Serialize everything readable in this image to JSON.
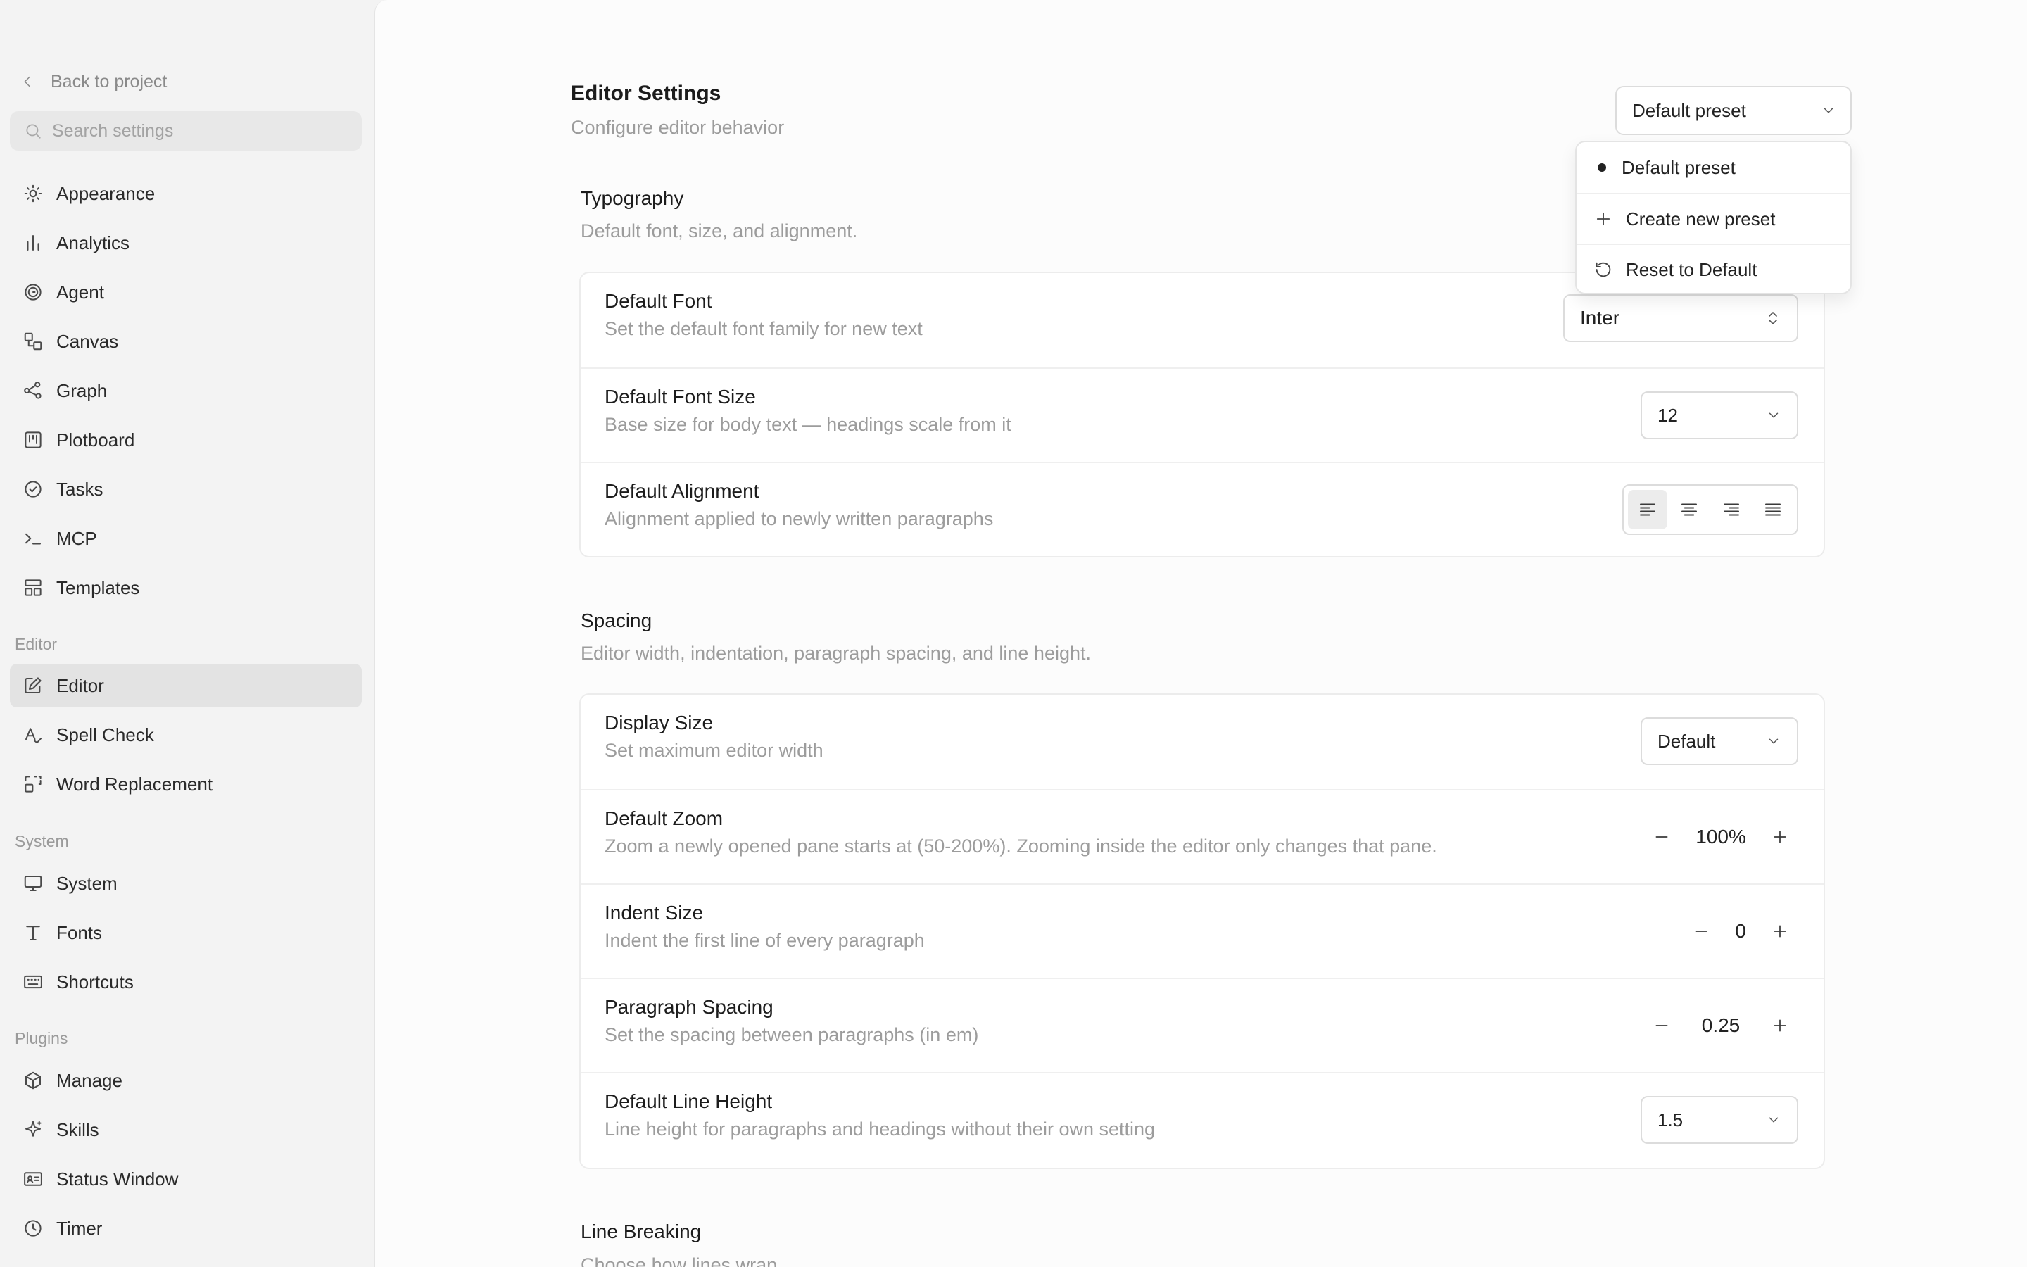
{
  "sidebar": {
    "back_label": "Back to project",
    "search_placeholder": "Search settings",
    "items_general": [
      {
        "label": "Appearance",
        "icon": "sun-icon"
      },
      {
        "label": "Analytics",
        "icon": "bar-chart-icon"
      },
      {
        "label": "Agent",
        "icon": "spiral-icon"
      },
      {
        "label": "Canvas",
        "icon": "shapes-icon"
      },
      {
        "label": "Graph",
        "icon": "graph-icon"
      },
      {
        "label": "Plotboard",
        "icon": "kanban-icon"
      },
      {
        "label": "Tasks",
        "icon": "check-circle-icon"
      },
      {
        "label": "MCP",
        "icon": "terminal-icon"
      },
      {
        "label": "Templates",
        "icon": "layout-template-icon"
      }
    ],
    "section_editor": "Editor",
    "items_editor": [
      {
        "label": "Editor",
        "icon": "edit-icon",
        "active": true
      },
      {
        "label": "Spell Check",
        "icon": "spell-check-icon"
      },
      {
        "label": "Word Replacement",
        "icon": "replace-icon"
      }
    ],
    "section_system": "System",
    "items_system": [
      {
        "label": "System",
        "icon": "monitor-icon"
      },
      {
        "label": "Fonts",
        "icon": "type-icon"
      },
      {
        "label": "Shortcuts",
        "icon": "keyboard-icon"
      }
    ],
    "section_plugins": "Plugins",
    "items_plugins": [
      {
        "label": "Manage",
        "icon": "package-icon"
      },
      {
        "label": "Skills",
        "icon": "sparkle-icon"
      },
      {
        "label": "Status Window",
        "icon": "id-card-icon"
      },
      {
        "label": "Timer",
        "icon": "clock-icon"
      }
    ]
  },
  "header": {
    "title": "Editor Settings",
    "subtitle": "Configure editor behavior",
    "preset_value": "Default preset"
  },
  "preset_menu": {
    "items": [
      {
        "label": "Default preset",
        "icon": "dot-icon",
        "selected": true
      },
      {
        "label": "Create new preset",
        "icon": "plus-icon"
      },
      {
        "label": "Reset to Default",
        "icon": "reset-icon"
      }
    ]
  },
  "typography": {
    "title": "Typography",
    "description": "Default font, size, and alignment.",
    "font": {
      "label": "Default Font",
      "description": "Set the default font family for new text",
      "value": "Inter"
    },
    "font_size": {
      "label": "Default Font Size",
      "description": "Base size for body text — headings scale from it",
      "value": "12"
    },
    "alignment": {
      "label": "Default Alignment",
      "description": "Alignment applied to newly written paragraphs",
      "options": [
        "left",
        "center",
        "right",
        "justify"
      ],
      "selected": "left"
    }
  },
  "spacing": {
    "title": "Spacing",
    "description": "Editor width, indentation, paragraph spacing, and line height.",
    "display_size": {
      "label": "Display Size",
      "description": "Set maximum editor width",
      "value": "Default"
    },
    "zoom": {
      "label": "Default Zoom",
      "description": "Zoom a newly opened pane starts at (50-200%). Zooming inside the editor only changes that pane.",
      "value": "100%"
    },
    "indent": {
      "label": "Indent Size",
      "description": "Indent the first line of every paragraph",
      "value": "0"
    },
    "paragraph_spacing": {
      "label": "Paragraph Spacing",
      "description": "Set the spacing between paragraphs (in em)",
      "value": "0.25"
    },
    "line_height": {
      "label": "Default Line Height",
      "description": "Line height for paragraphs and headings without their own setting",
      "value": "1.5"
    }
  },
  "line_breaking": {
    "title": "Line Breaking",
    "description": "Choose how lines wrap"
  }
}
